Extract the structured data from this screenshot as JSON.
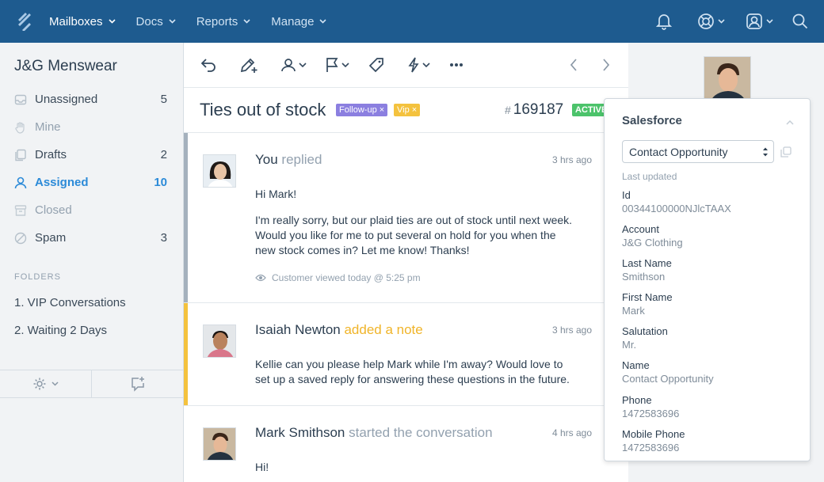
{
  "nav": {
    "items": [
      {
        "label": "Mailboxes"
      },
      {
        "label": "Docs"
      },
      {
        "label": "Reports"
      },
      {
        "label": "Manage"
      }
    ],
    "icons": [
      "bell-icon",
      "help-lifebuoy-icon",
      "user-account-icon",
      "search-icon"
    ]
  },
  "sidebar": {
    "mailbox_name": "J&G Menswear",
    "folders": [
      {
        "label": "Unassigned",
        "count": "5"
      },
      {
        "label": "Mine",
        "count": ""
      },
      {
        "label": "Drafts",
        "count": "2"
      },
      {
        "label": "Assigned",
        "count": "10"
      },
      {
        "label": "Closed",
        "count": ""
      },
      {
        "label": "Spam",
        "count": "3"
      }
    ],
    "folders_heading": "FOLDERS",
    "custom_folders": [
      {
        "label": "1. VIP Conversations"
      },
      {
        "label": "2. Waiting 2 Days"
      }
    ]
  },
  "conversation": {
    "subject": "Ties out of stock",
    "tags": [
      {
        "label": "Follow-up ×",
        "color": "#8b7fe0"
      },
      {
        "label": "Vip ×",
        "color": "#f4c23e"
      }
    ],
    "hash": "#",
    "number": "169187",
    "status": "ACTIVE",
    "threads": [
      {
        "author": "You",
        "action": "replied",
        "time": "3 hrs ago",
        "greeting": "Hi Mark!",
        "body": "I'm really sorry, but our plaid ties are out of stock until next week. Would you like for me to put several on hold for you when the new stock comes in? Let me know! Thanks!",
        "viewed": "Customer viewed today @ 5:25 pm"
      },
      {
        "author": "Isaiah Newton",
        "action": "added a note",
        "time": "3 hrs ago",
        "body": "Kellie can you please help Mark while I'm away? Would love to set up a saved reply for answering these questions in the future."
      },
      {
        "author": "Mark Smithson",
        "action": "started the conversation",
        "time": "4 hrs ago",
        "greeting": "Hi!"
      }
    ]
  },
  "salesforce": {
    "title": "Salesforce",
    "selected_object": "Contact Opportunity",
    "last_updated_label": "Last updated",
    "fields": [
      {
        "key": "Id",
        "value": "00344100000NJlcTAAX"
      },
      {
        "key": "Account",
        "value": "J&G Clothing"
      },
      {
        "key": "Last Name",
        "value": "Smithson"
      },
      {
        "key": "First Name",
        "value": "Mark"
      },
      {
        "key": "Salutation",
        "value": "Mr."
      },
      {
        "key": "Name",
        "value": "Contact Opportunity"
      },
      {
        "key": "Phone",
        "value": "1472583696"
      },
      {
        "key": "Mobile Phone",
        "value": "1472583696"
      }
    ]
  },
  "colors": {
    "nav_bg": "#1e5b8f",
    "accent_blue": "#2b8ad8",
    "note_yellow": "#f0b429",
    "active_green": "#4cc36b"
  }
}
